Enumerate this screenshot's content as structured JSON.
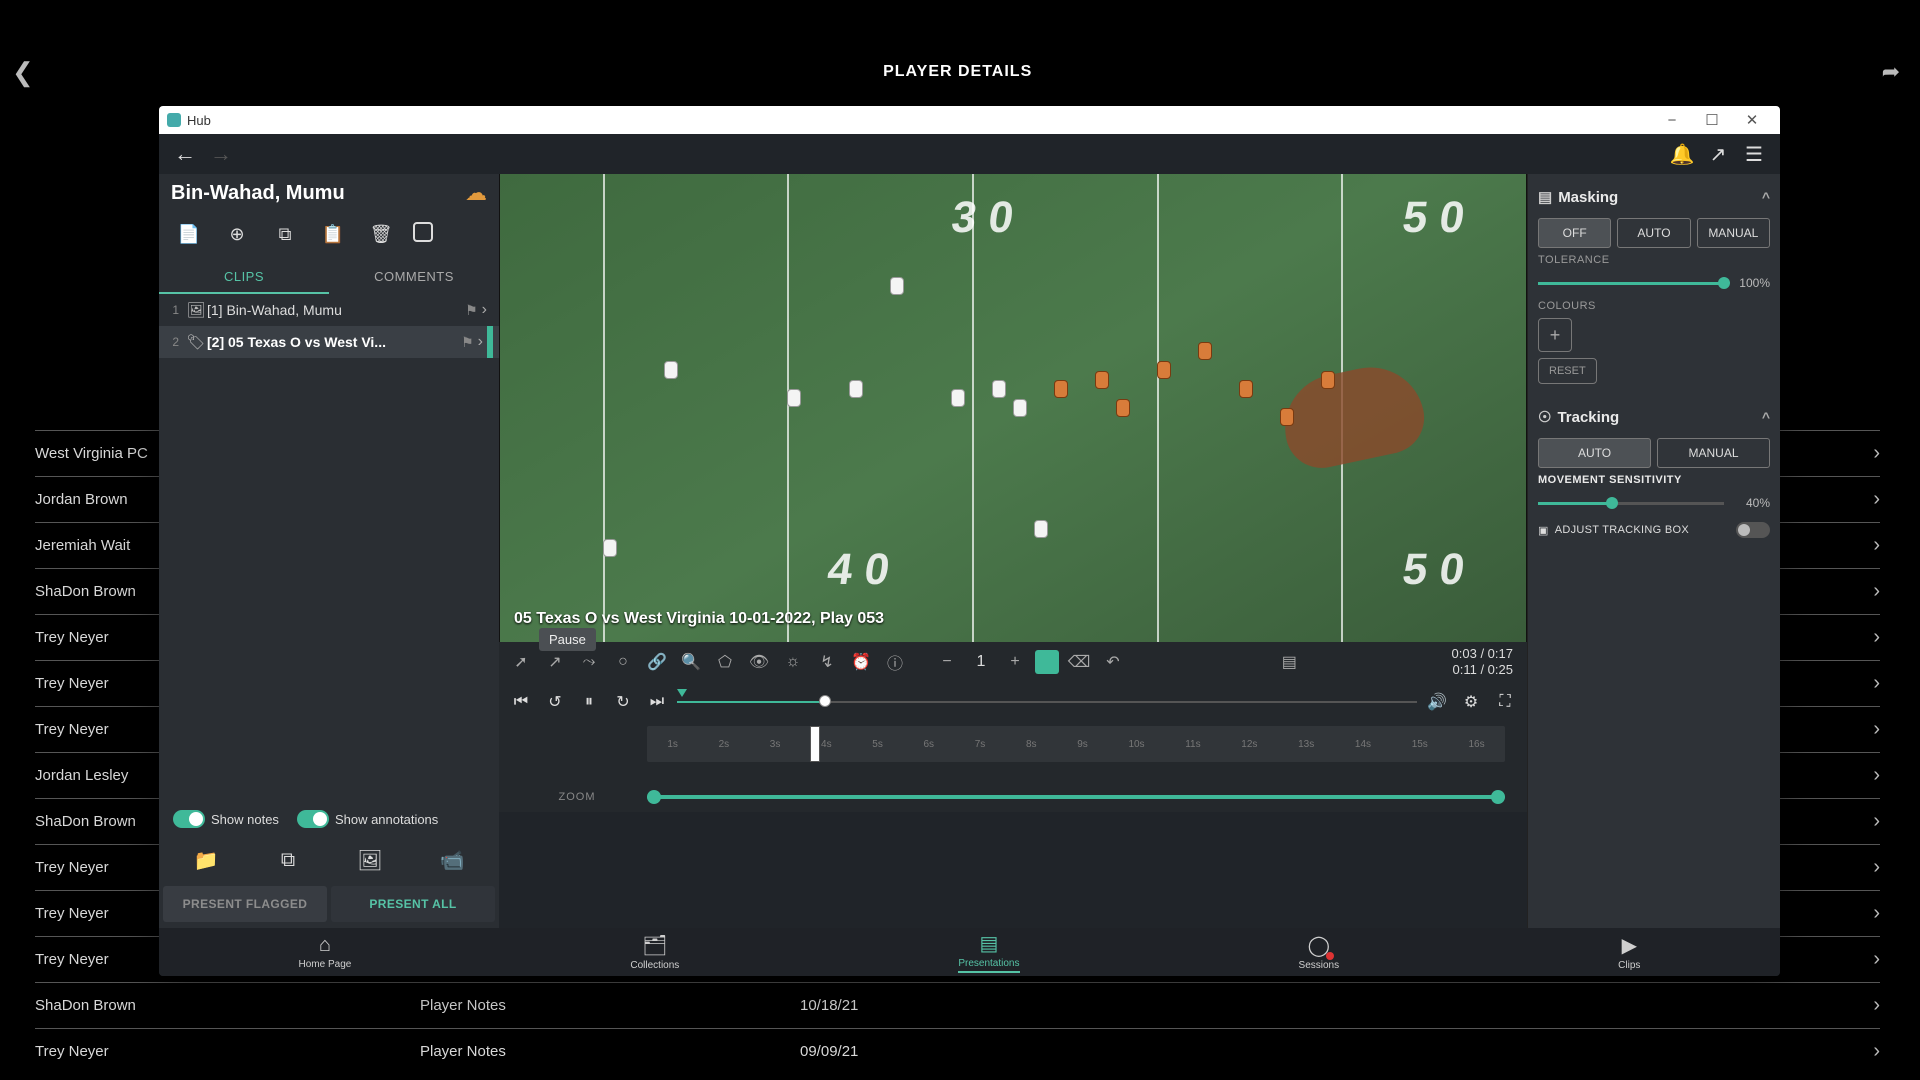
{
  "app": {
    "title": "PLAYER DETAILS"
  },
  "window": {
    "title": "Hub",
    "player_name": "Bin-Wahad, Mumu",
    "tabs": {
      "clips": "CLIPS",
      "comments": "COMMENTS"
    }
  },
  "clips": [
    {
      "idx": "1",
      "label": "[1] Bin-Wahad, Mumu"
    },
    {
      "idx": "2",
      "label": "[2] 05 Texas O vs West Vi..."
    }
  ],
  "sidebar_toggles": {
    "show_notes": "Show notes",
    "show_annotations": "Show annotations"
  },
  "present": {
    "flagged": "PRESENT FLAGGED",
    "all": "PRESENT ALL"
  },
  "video": {
    "caption": "05 Texas O vs West Virginia 10-01-2022, Play 053",
    "tooltip": "Pause",
    "time_a": "0:03 / 0:17",
    "time_b": "0:11 / 0:25",
    "brush_size": "1"
  },
  "timeline_labels": [
    "1s",
    "2s",
    "3s",
    "4s",
    "5s",
    "6s",
    "7s",
    "8s",
    "9s",
    "10s",
    "11s",
    "12s",
    "13s",
    "14s",
    "15s",
    "16s"
  ],
  "zoom_label": "ZOOM",
  "right_panel": {
    "masking_title": "Masking",
    "off": "OFF",
    "auto": "AUTO",
    "manual": "MANUAL",
    "tolerance_label": "TOLERANCE",
    "tolerance_value": "100%",
    "colours_label": "COLOURS",
    "reset": "RESET",
    "tracking_title": "Tracking",
    "movement_label": "MOVEMENT SENSITIVITY",
    "movement_value": "40%",
    "adjust_label": "ADJUST TRACKING BOX"
  },
  "footer": {
    "home": "Home Page",
    "collections": "Collections",
    "presentations": "Presentations",
    "sessions": "Sessions",
    "clips": "Clips"
  },
  "bg_rows": [
    {
      "name": "West Virginia PC",
      "notes": "",
      "date": ""
    },
    {
      "name": "Jordan Brown",
      "notes": "",
      "date": ""
    },
    {
      "name": "Jeremiah Wait",
      "notes": "",
      "date": ""
    },
    {
      "name": "ShaDon Brown",
      "notes": "",
      "date": ""
    },
    {
      "name": "Trey Neyer",
      "notes": "",
      "date": ""
    },
    {
      "name": "Trey Neyer",
      "notes": "",
      "date": ""
    },
    {
      "name": "Trey Neyer",
      "notes": "",
      "date": ""
    },
    {
      "name": "Jordan Lesley",
      "notes": "",
      "date": ""
    },
    {
      "name": "ShaDon Brown",
      "notes": "",
      "date": ""
    },
    {
      "name": "Trey Neyer",
      "notes": "",
      "date": ""
    },
    {
      "name": "Trey Neyer",
      "notes": "",
      "date": ""
    },
    {
      "name": "Trey Neyer",
      "notes": "",
      "date": ""
    },
    {
      "name": "ShaDon Brown",
      "notes": "Player Notes",
      "date": "10/18/21"
    },
    {
      "name": "Trey Neyer",
      "notes": "Player Notes",
      "date": "09/09/21"
    }
  ],
  "field_numbers": {
    "n40": "4 0",
    "n50": "5 0",
    "n30t": "3 0"
  }
}
